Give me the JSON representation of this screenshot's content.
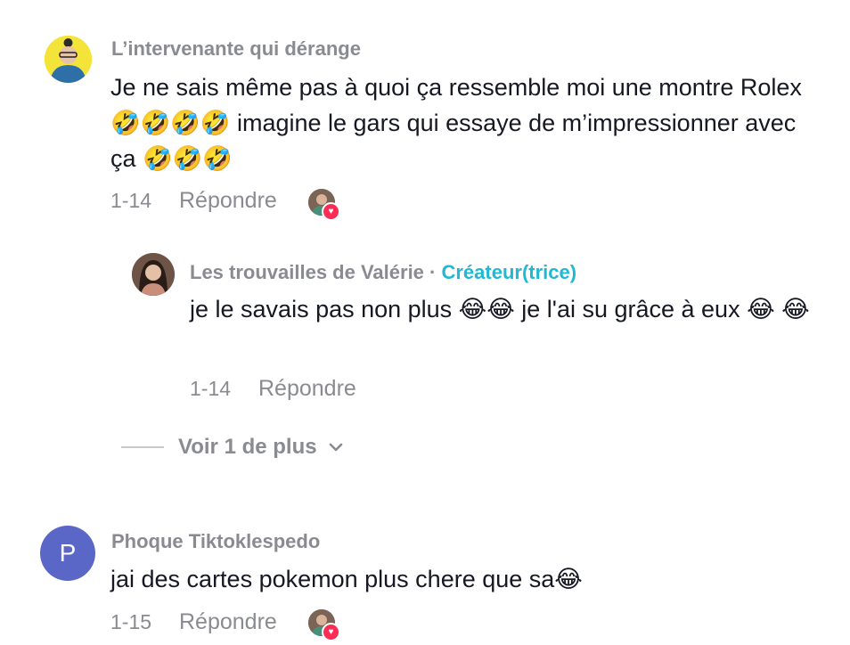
{
  "comments": [
    {
      "username": "L’intervenante qui dérange",
      "text": "Je ne sais même pas à quoi ça ressemble moi une montre Rolex 🤣🤣🤣🤣 imagine le gars qui essaye de m’impressionner avec ça 🤣🤣🤣",
      "date": "1-14",
      "reply_label": "Répondre",
      "replies": [
        {
          "username": "Les trouvailles de Valérie",
          "separator": " · ",
          "badge": "Créateur(trice)",
          "text": "je le savais pas non plus 😂😂 je l'ai su grâce à eux 😂 😂",
          "date": "1-14",
          "reply_label": "Répondre"
        }
      ],
      "more_label": "Voir 1 de plus"
    },
    {
      "username": "Phoque Tiktoklespedo",
      "avatar_letter": "P",
      "text": "jai des cartes pokemon plus chere que sa😂",
      "date": "1-15",
      "reply_label": "Répondre"
    }
  ],
  "colors": {
    "username": "#8a8b91",
    "text": "#161823",
    "creator_badge": "#20b8d2",
    "heart": "#fe2c55",
    "avatar_p": "#5b67c7"
  },
  "icons": [
    "liked-by-creator-icon",
    "heart-icon",
    "chevron-down-icon"
  ]
}
